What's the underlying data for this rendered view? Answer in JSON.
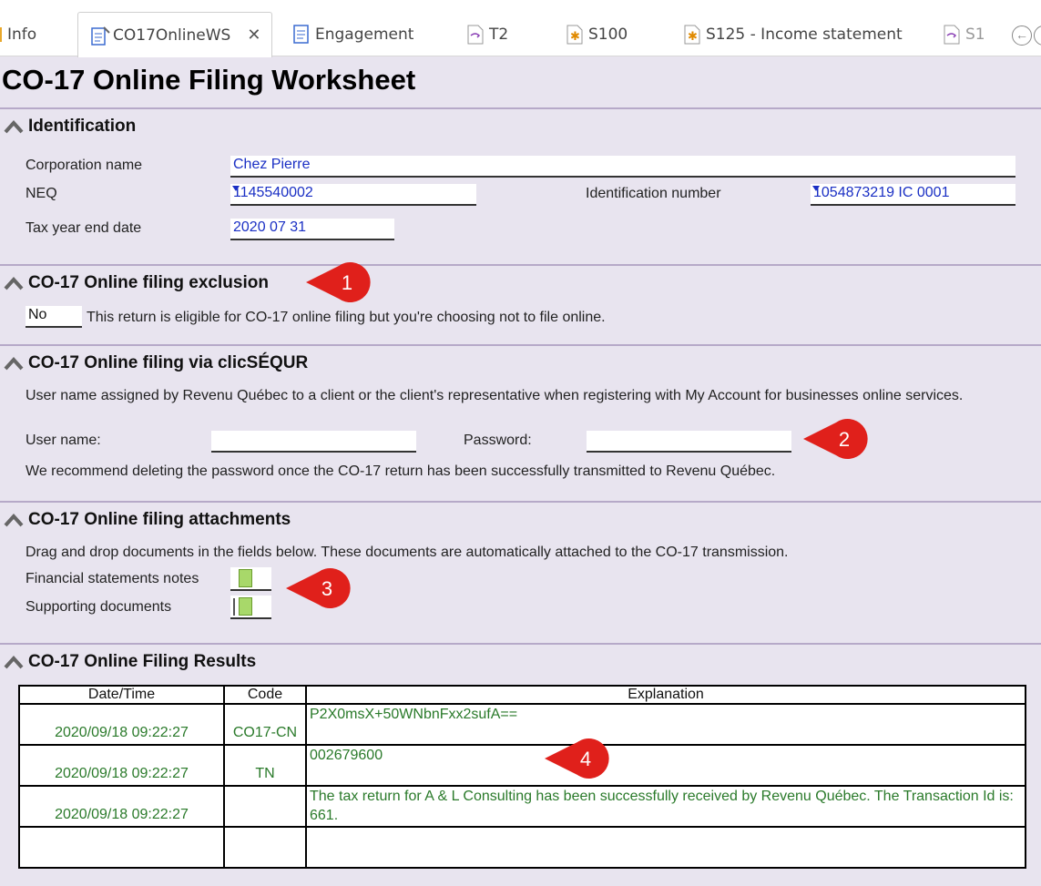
{
  "tabs": [
    {
      "label": "Info"
    },
    {
      "label": "CO17OnlineWS"
    },
    {
      "label": "Engagement"
    },
    {
      "label": "T2"
    },
    {
      "label": "S100"
    },
    {
      "label": "S125 - Income statement"
    },
    {
      "label": "S1"
    }
  ],
  "page_title": "CO-17 Online Filing Worksheet",
  "identification": {
    "heading": "Identification",
    "corp_name_label": "Corporation name",
    "corp_name_value": "Chez Pierre",
    "neq_label": "NEQ",
    "neq_value": "1145540002",
    "id_number_label": "Identification number",
    "id_number_value": "1054873219 IC 0001",
    "tax_year_label": "Tax year end date",
    "tax_year_value": "2020 07 31"
  },
  "exclusion": {
    "heading": "CO-17 Online filing exclusion",
    "value": "No",
    "text": "This return is eligible for CO-17 online filing but you're choosing not to file online."
  },
  "clicsequr": {
    "heading": "CO-17 Online filing via clicSÉQUR",
    "description": "User name assigned by Revenu Québec to a client or the client's representative when registering with My Account for businesses online services.",
    "username_label": "User name:",
    "username_value": "",
    "password_label": "Password:",
    "password_value": "",
    "note": "We recommend deleting the password once the CO-17 return has been successfully transmitted to Revenu Québec."
  },
  "attachments": {
    "heading": "CO-17 Online filing attachments",
    "description": "Drag and drop documents in the fields below. These documents are automatically attached to the CO-17 transmission.",
    "financial_label": "Financial statements notes",
    "supporting_label": "Supporting documents"
  },
  "results": {
    "heading": "CO-17 Online Filing Results",
    "columns": [
      "Date/Time",
      "Code",
      "Explanation"
    ],
    "rows": [
      {
        "datetime": "2020/09/18 09:22:27",
        "code": "CO17-CN",
        "explanation": "P2X0msX+50WNbnFxx2sufA=="
      },
      {
        "datetime": "2020/09/18 09:22:27",
        "code": "TN",
        "explanation": "002679600"
      },
      {
        "datetime": "2020/09/18 09:22:27",
        "code": "",
        "explanation": "The tax return for A & L Consulting has been successfully received by Revenu Québec. The Transaction Id is: 661."
      },
      {
        "datetime": "",
        "code": "",
        "explanation": ""
      }
    ]
  },
  "callouts": [
    "1",
    "2",
    "3",
    "4"
  ],
  "colors": {
    "callout": "#e0201b",
    "section_rule": "#b6a9c8",
    "value_blue": "#1a2fc4",
    "result_green": "#2a7a2a"
  }
}
